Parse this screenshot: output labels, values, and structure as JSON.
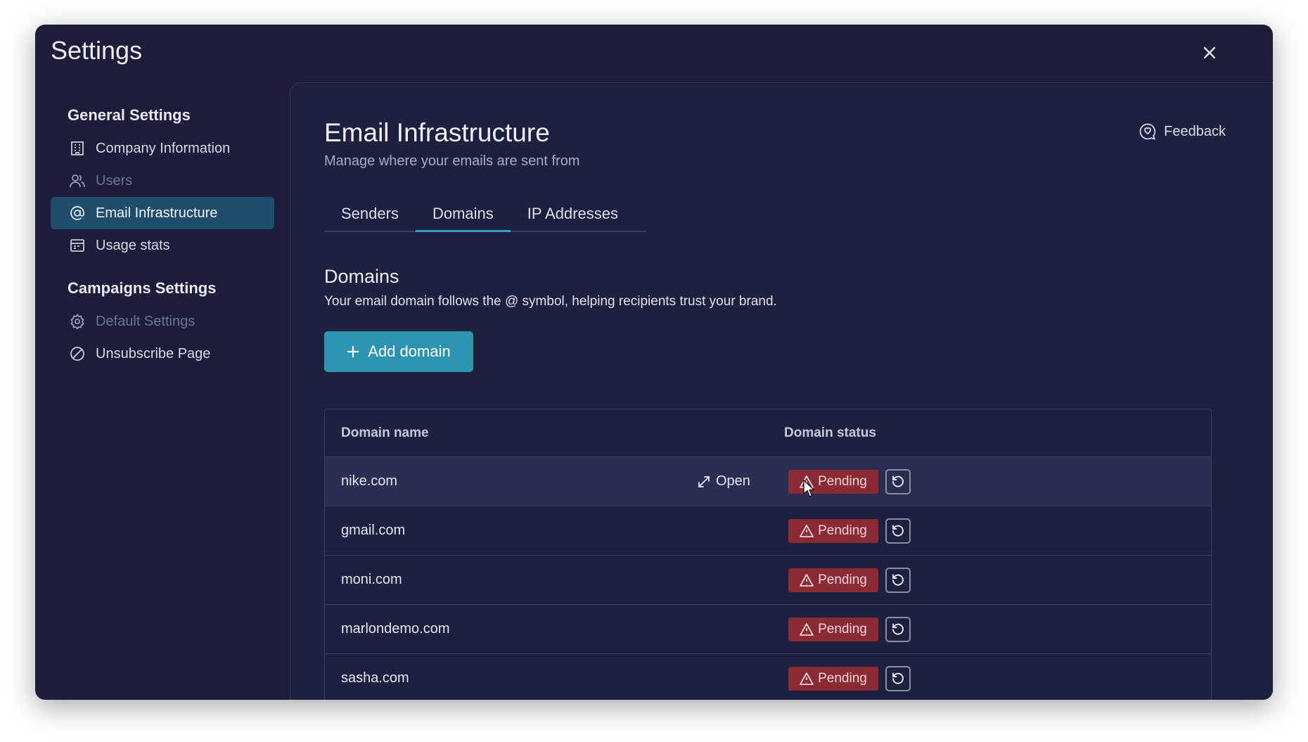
{
  "window": {
    "title": "Settings"
  },
  "sidebar": {
    "general_heading": "General Settings",
    "general_items": [
      {
        "label": "Company Information",
        "icon": "building-icon",
        "state": "normal"
      },
      {
        "label": "Users",
        "icon": "users-icon",
        "state": "disabled"
      },
      {
        "label": "Email Infrastructure",
        "icon": "at-sign-icon",
        "state": "active"
      },
      {
        "label": "Usage stats",
        "icon": "calendar-icon",
        "state": "normal"
      }
    ],
    "campaigns_heading": "Campaigns Settings",
    "campaigns_items": [
      {
        "label": "Default Settings",
        "icon": "gear-icon",
        "state": "disabled"
      },
      {
        "label": "Unsubscribe Page",
        "icon": "ban-icon",
        "state": "normal"
      }
    ]
  },
  "main": {
    "title": "Email Infrastructure",
    "subtitle": "Manage where your emails are sent from",
    "feedback_label": "Feedback",
    "tabs": [
      {
        "label": "Senders",
        "active": false
      },
      {
        "label": "Domains",
        "active": true
      },
      {
        "label": "IP Addresses",
        "active": false
      }
    ],
    "section_title": "Domains",
    "section_desc": "Your email domain follows the @ symbol, helping recipients trust your brand.",
    "add_button_label": "Add domain",
    "table": {
      "headers": {
        "name": "Domain name",
        "status": "Domain status"
      },
      "open_label": "Open",
      "rows": [
        {
          "domain": "nike.com",
          "status": "Pending",
          "hover": true
        },
        {
          "domain": "gmail.com",
          "status": "Pending",
          "hover": false
        },
        {
          "domain": "moni.com",
          "status": "Pending",
          "hover": false
        },
        {
          "domain": "marlondemo.com",
          "status": "Pending",
          "hover": false
        },
        {
          "domain": "sasha.com",
          "status": "Pending",
          "hover": false
        }
      ]
    }
  },
  "colors": {
    "background": "#1b1d3a",
    "panel": "#1e2040",
    "accent": "#2d94b0",
    "active_nav": "#1e4d6e",
    "pending_badge": "#8a2a35"
  }
}
